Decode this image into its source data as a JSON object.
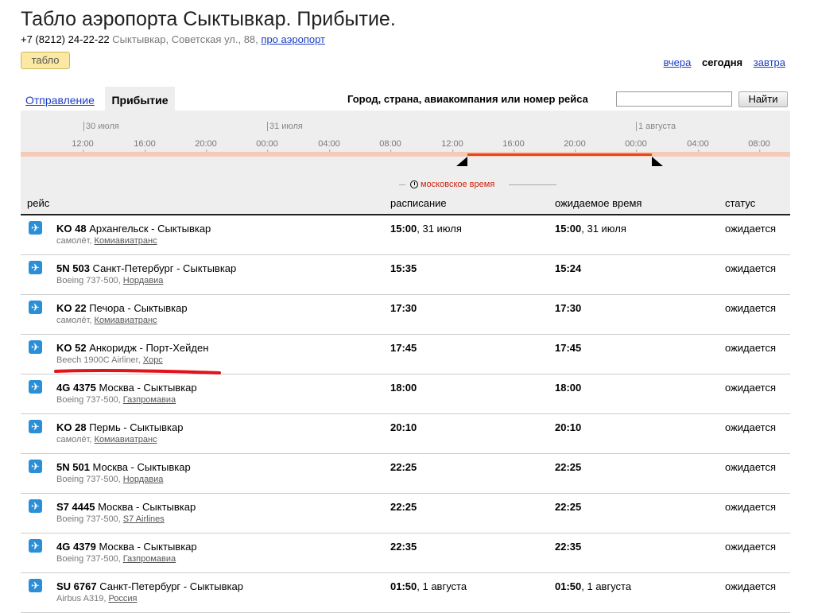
{
  "header": {
    "title": "Табло аэропорта Сыктывкар. Прибытие.",
    "phone": "+7 (8212) 24-22-22",
    "address": "Сыктывкар, Советская ул., 88,",
    "about_link": "про аэропорт",
    "tablo_button": "табло"
  },
  "days": {
    "yesterday": "вчера",
    "today": "сегодня",
    "tomorrow": "завтра"
  },
  "tabs": {
    "departure": "Отправление",
    "arrival": "Прибытие"
  },
  "search": {
    "label": "Город, страна, авиакомпания или номер рейса",
    "value": "",
    "button": "Найти"
  },
  "timeline": {
    "dates": [
      "30 июля",
      "31 июля",
      "1 августа"
    ],
    "hours": [
      "12:00",
      "16:00",
      "20:00",
      "00:00",
      "04:00",
      "08:00",
      "12:00",
      "16:00",
      "20:00",
      "00:00",
      "04:00",
      "08:00"
    ]
  },
  "timezone": "московское время",
  "columns": {
    "flight": "рейс",
    "schedule": "расписание",
    "expected": "ожидаемое время",
    "status": "статус"
  },
  "flights": [
    {
      "code": "KO 48",
      "route": "Архангельск - Сыктывкар",
      "aircraft": "самолёт,",
      "airline": "Комиавиатранс",
      "sched_time": "15:00",
      "sched_date": ", 31 июля",
      "exp_time": "15:00",
      "exp_date": ", 31 июля",
      "status": "ожидается"
    },
    {
      "code": "5N 503",
      "route": "Санкт-Петербург - Сыктывкар",
      "aircraft": "Boeing 737-500,",
      "airline": "Нордавиа",
      "sched_time": "15:35",
      "sched_date": "",
      "exp_time": "15:24",
      "exp_date": "",
      "status": "ожидается"
    },
    {
      "code": "KO 22",
      "route": "Печора - Сыктывкар",
      "aircraft": "самолёт,",
      "airline": "Комиавиатранс",
      "sched_time": "17:30",
      "sched_date": "",
      "exp_time": "17:30",
      "exp_date": "",
      "status": "ожидается"
    },
    {
      "code": "KO 52",
      "route": "Анкоридж - Порт-Хейден",
      "aircraft": "Beech 1900C Airliner,",
      "airline": "Хорс",
      "sched_time": "17:45",
      "sched_date": "",
      "exp_time": "17:45",
      "exp_date": "",
      "status": "ожидается"
    },
    {
      "code": "4G 4375",
      "route": "Москва - Сыктывкар",
      "aircraft": "Boeing 737-500,",
      "airline": "Газпромавиа",
      "sched_time": "18:00",
      "sched_date": "",
      "exp_time": "18:00",
      "exp_date": "",
      "status": "ожидается"
    },
    {
      "code": "KO 28",
      "route": "Пермь - Сыктывкар",
      "aircraft": "самолёт,",
      "airline": "Комиавиатранс",
      "sched_time": "20:10",
      "sched_date": "",
      "exp_time": "20:10",
      "exp_date": "",
      "status": "ожидается"
    },
    {
      "code": "5N 501",
      "route": "Москва - Сыктывкар",
      "aircraft": "Boeing 737-500,",
      "airline": "Нордавиа",
      "sched_time": "22:25",
      "sched_date": "",
      "exp_time": "22:25",
      "exp_date": "",
      "status": "ожидается"
    },
    {
      "code": "S7 4445",
      "route": "Москва - Сыктывкар",
      "aircraft": "Boeing 737-500,",
      "airline": "S7 Airlines",
      "sched_time": "22:25",
      "sched_date": "",
      "exp_time": "22:25",
      "exp_date": "",
      "status": "ожидается"
    },
    {
      "code": "4G 4379",
      "route": "Москва - Сыктывкар",
      "aircraft": "Boeing 737-500,",
      "airline": "Газпромавиа",
      "sched_time": "22:35",
      "sched_date": "",
      "exp_time": "22:35",
      "exp_date": "",
      "status": "ожидается"
    },
    {
      "code": "SU 6767",
      "route": "Санкт-Петербург - Сыктывкар",
      "aircraft": "Airbus A319,",
      "airline": "Россия",
      "sched_time": "01:50",
      "sched_date": ", 1 августа",
      "exp_time": "01:50",
      "exp_date": ", 1 августа",
      "status": "ожидается"
    }
  ]
}
